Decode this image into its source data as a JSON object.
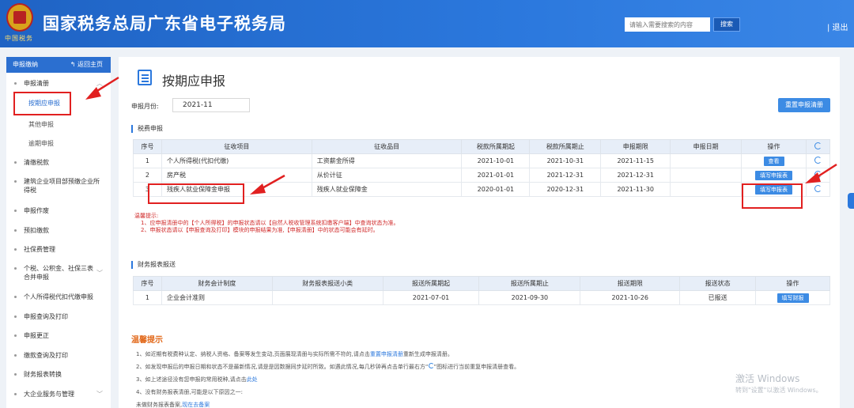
{
  "header": {
    "emblem_caption": "中国税务",
    "title": "国家税务总局广东省电子税务局",
    "search_placeholder": "请输入需要搜索的内容",
    "search_button": "搜索",
    "logout": "| 退出"
  },
  "sidebar": {
    "header": "申报缴纳",
    "home": "返回主页",
    "items": [
      {
        "label": "申报清册",
        "sub": [
          "按期应申报",
          "其他申报",
          "逾期申报"
        ]
      },
      {
        "label": "清缴税款"
      },
      {
        "label": "建筑企业项目部预缴企业所得税"
      },
      {
        "label": "申报作废"
      },
      {
        "label": "预扣缴款"
      },
      {
        "label": "社保费管理"
      },
      {
        "label": "个税、公积金、社保三表合并申报"
      },
      {
        "label": "个人所得税代扣代缴申报"
      },
      {
        "label": "申报查询及打印"
      },
      {
        "label": "申报更正"
      },
      {
        "label": "缴款查询及打印"
      },
      {
        "label": "财务报表转换"
      },
      {
        "label": "大企业服务与管理"
      }
    ]
  },
  "main": {
    "title": "按期应申报",
    "period_label": "申报月份:",
    "period_value": "2021-11",
    "reset_button": "重置申报清册",
    "tax_section": "税费申报",
    "tax_headers": [
      "序号",
      "征收项目",
      "征收品目",
      "税款所属期起",
      "税款所属期止",
      "申报期限",
      "申报日期",
      "操作"
    ],
    "tax_rows": [
      {
        "no": "1",
        "item": "个人所得税(代扣代缴)",
        "sub": "工资薪金所得",
        "start": "2021-10-01",
        "end": "2021-10-31",
        "deadline": "2021-11-15",
        "date": "",
        "op": "查看"
      },
      {
        "no": "2",
        "item": "房产税",
        "sub": "从价计征",
        "start": "2021-01-01",
        "end": "2021-12-31",
        "deadline": "2021-12-31",
        "date": "",
        "op": "填写申报表"
      },
      {
        "no": "3",
        "item": "残疾人就业保障金申报",
        "sub": "残疾人就业保障金",
        "start": "2020-01-01",
        "end": "2020-12-31",
        "deadline": "2021-11-30",
        "date": "",
        "op": "填写申报表"
      }
    ],
    "warm_tips_red": [
      "温馨提示:",
      "1、应申报清册中的【个人所得税】的申报状态请以【自然人税收管理系统扣缴客户端】中查询状态为准。",
      "2、申报状态请以【申报查询及打印】模块的申报结果为准,【申报清册】中的状态可能会有延时。"
    ],
    "fin_section": "财务报表报送",
    "fin_headers": [
      "序号",
      "财务会计制度",
      "财务报表报送小类",
      "报送所属期起",
      "报送所属期止",
      "报送期限",
      "报送状态",
      "操作"
    ],
    "fin_rows": [
      {
        "no": "1",
        "system": "企业会计准则",
        "type": "",
        "start": "2021-07-01",
        "end": "2021-09-30",
        "deadline": "2021-10-26",
        "status": "已报送",
        "op": "填写财报"
      }
    ],
    "tips_title": "温馨提示",
    "tips": [
      "1、如近期有税费种认定、纳税人资格、备案等发生变动,页面展现清册与实际所需不符的,请点击",
      "重置申报清册",
      "重新生成申报清册。",
      "2、如发现申报后的申报日期和状态不是最新情况,请是是因数据同步延时所致。如遇此情况,每几秒钟再点击单行最右方“",
      "”图标进行当前重复申报清册查看。",
      "3、如上述途径没有您申报的常用税种,请点击",
      "此处",
      "4、没有财务报表清册,可能是以下原因之一:",
      "未做财务报表备案,",
      "现在去备案"
    ]
  },
  "watermark": {
    "line1": "激活 Windows",
    "line2": "转到\"设置\"以激活 Windows。"
  }
}
